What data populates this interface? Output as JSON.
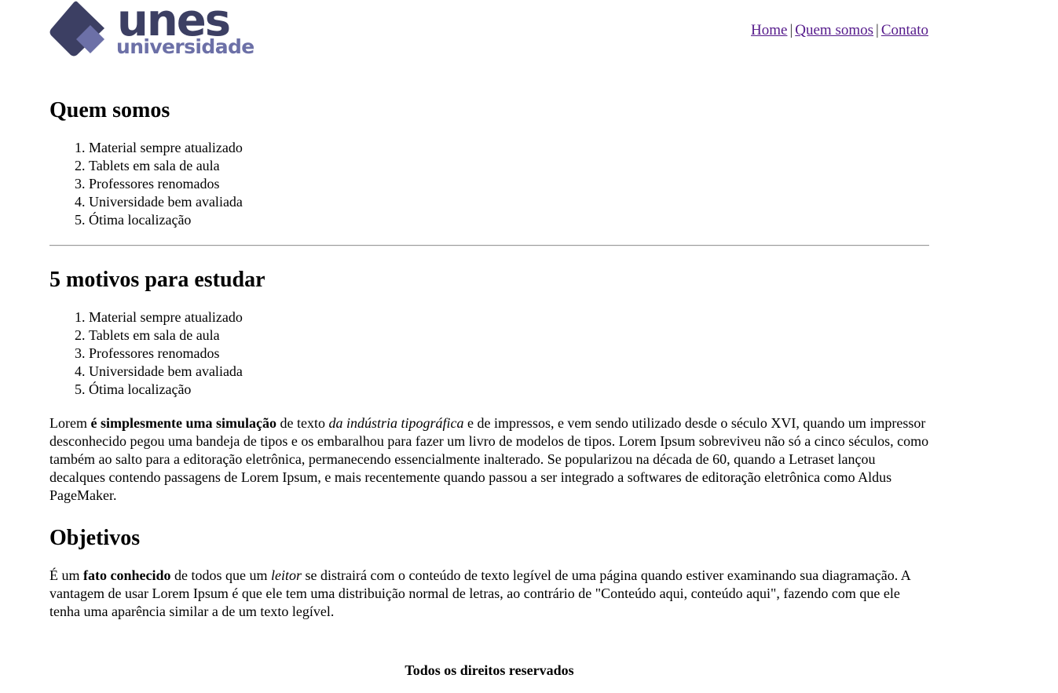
{
  "header": {
    "logo": {
      "word_top": "unes",
      "word_bottom": "universidade",
      "color_dark": "#3c3f63",
      "color_light": "#6c70a7"
    },
    "nav": {
      "items": [
        {
          "label": "Home"
        },
        {
          "label": "Quem somos"
        },
        {
          "label": "Contato"
        }
      ],
      "separator": "|"
    }
  },
  "sections": {
    "quem_somos": {
      "heading": "Quem somos",
      "list": [
        "Material sempre atualizado",
        "Tablets em sala de aula",
        "Professores renomados",
        "Universidade bem avaliada",
        "Ótima localização"
      ]
    },
    "motivos": {
      "heading": "5 motivos para estudar",
      "list": [
        "Material sempre atualizado",
        "Tablets em sala de aula",
        "Professores renomados",
        "Universidade bem avaliada",
        "Ótima localização"
      ],
      "paragraph": {
        "part1": "Lorem ",
        "bold": "é simplesmente uma simulação",
        "part2": " de texto ",
        "italic": "da indústria tipográfica",
        "part3": " e de impressos, e vem sendo utilizado desde o século XVI, quando um impressor desconhecido pegou uma bandeja de tipos e os embaralhou para fazer um livro de modelos de tipos. Lorem Ipsum sobreviveu não só a cinco séculos, como também ao salto para a editoração eletrônica, permanecendo essencialmente inalterado. Se popularizou na década de 60, quando a Letraset lançou decalques contendo passagens de Lorem Ipsum, e mais recentemente quando passou a ser integrado a softwares de editoração eletrônica como Aldus PageMaker."
      }
    },
    "objetivos": {
      "heading": "Objetivos",
      "paragraph": {
        "part1": "É um ",
        "bold": "fato conhecido",
        "part2": " de todos que um ",
        "italic": "leitor",
        "part3": " se distrairá com o conteúdo de texto legível de uma página quando estiver examinando sua diagramação. A vantagem de usar Lorem Ipsum é que ele tem uma distribuição normal de letras, ao contrário de \"Conteúdo aqui, conteúdo aqui\", fazendo com que ele tenha uma aparência similar a de um texto legível."
      }
    }
  },
  "footer": {
    "text": "Todos os direitos reservados"
  }
}
